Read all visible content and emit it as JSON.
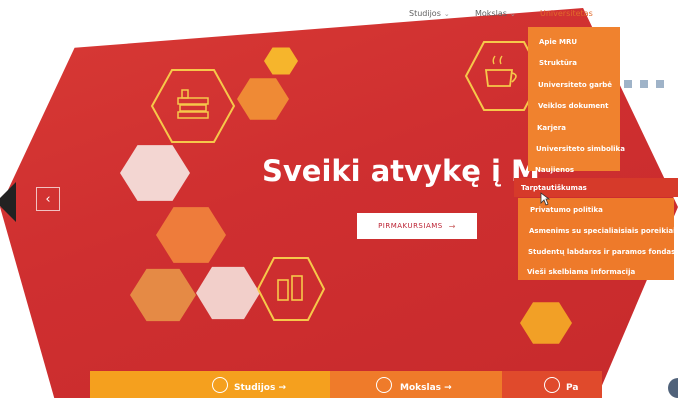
{
  "nav": {
    "items": [
      {
        "label": "Studijos",
        "caret": "⌄"
      },
      {
        "label": "Mokslas",
        "caret": "⌄"
      },
      {
        "label": "Universitetas"
      }
    ]
  },
  "hero": {
    "title": "Sveiki atvykę į M",
    "button_label": "PIRMAKURSIAMS",
    "button_arrow": "→",
    "prev_arrow": "‹"
  },
  "dropdown": {
    "items": [
      "Apie MRU",
      "Struktūra",
      "Universiteto garbė",
      "Veiklos dokument",
      "Karjera",
      "Universiteto simbolika",
      "Naujienos",
      "Tarptautiškumas",
      "Privatumo politika",
      "Asmenims su specialiaisiais poreikiais",
      "Studentų labdaros ir paramos fondas",
      "Vieši skelbiama informacija"
    ],
    "selected": "Tarptautiškumas"
  },
  "bottom": {
    "items": [
      "Studijos →",
      "Mokslas →",
      "Pa"
    ]
  },
  "colors": {
    "hero_red": "#d0312f",
    "dropdown_orange": "#f0822e",
    "accent_orange": "#e06a2b",
    "selected_red": "#d63a2a"
  },
  "icons": [
    "books-icon",
    "coffee-cup-icon",
    "bottle-icon",
    "chevron-left-icon"
  ]
}
